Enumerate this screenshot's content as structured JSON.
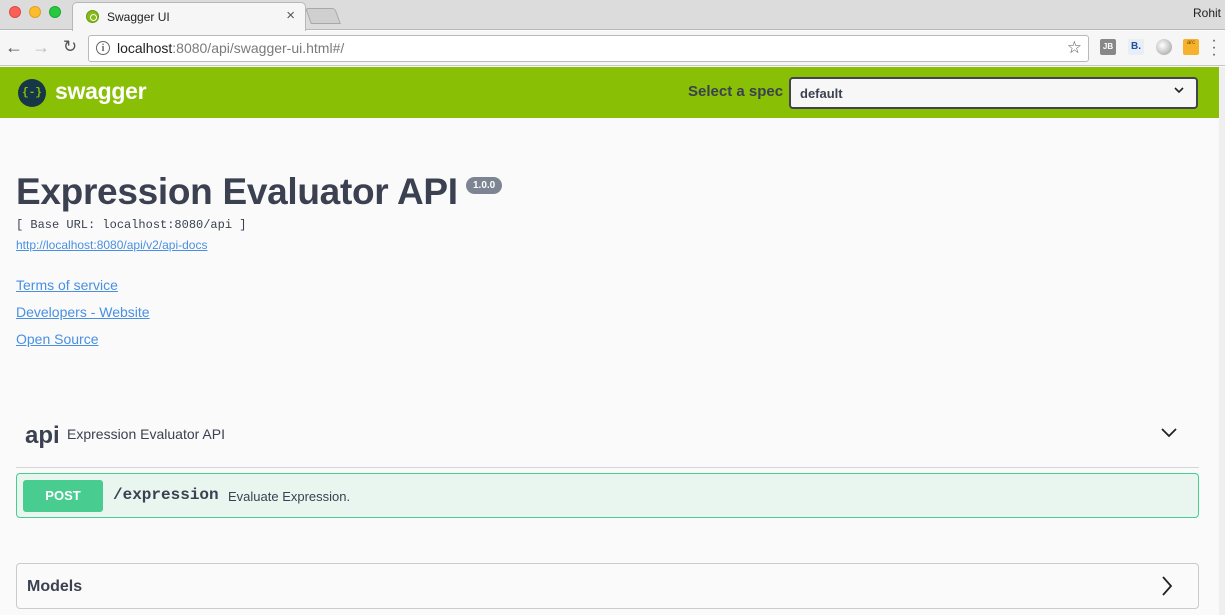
{
  "browser": {
    "tab_title": "Swagger UI",
    "tab_close": "×",
    "profile_name": "Rohit",
    "url_host": "localhost",
    "url_rest": ":8080/api/swagger-ui.html#/",
    "star_glyph": "☆",
    "extensions": [
      "JB",
      "B.",
      "",
      "arc"
    ]
  },
  "topbar": {
    "logo_text": "swagger",
    "logo_glyph": "{-}",
    "spec_label": "Select a spec",
    "spec_value": "default"
  },
  "info": {
    "title": "Expression Evaluator API",
    "version": "1.0.0",
    "base_url": "[ Base URL: localhost:8080/api ]",
    "api_docs_link": "http://localhost:8080/api/v2/api-docs",
    "links": [
      "Terms of service",
      "Developers - Website",
      "Open Source"
    ]
  },
  "tag": {
    "name": "api",
    "description": "Expression Evaluator API"
  },
  "operation": {
    "method": "POST",
    "path": "/expression",
    "summary": "Evaluate Expression."
  },
  "models": {
    "title": "Models"
  },
  "colors": {
    "topbar": "#89bf04",
    "post": "#49cc90",
    "text": "#3b4151",
    "link": "#4990e2"
  }
}
